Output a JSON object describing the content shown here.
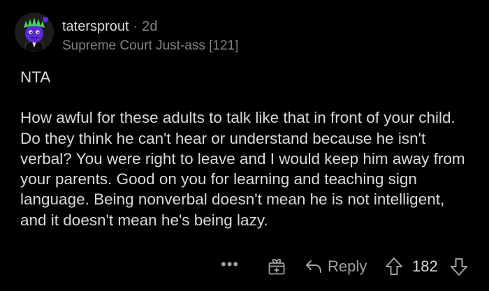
{
  "comment": {
    "author": "tatersprout",
    "separator": "·",
    "age": "2d",
    "flair": "Supreme Court Just-ass [121]",
    "paragraphs": [
      "NTA",
      "How awful for these adults to talk like that in front of your child. Do they think he can't hear or understand because he isn't verbal? You were right to leave and I would keep him away from your parents. Good on you for learning and teaching sign language. Being nonverbal doesn't mean he is not intelligent, and it doesn't mean he's being lazy."
    ]
  },
  "actions": {
    "more": "•••",
    "award_icon": "gift-icon",
    "reply_icon": "reply-arrow-icon",
    "reply_label": "Reply",
    "upvote_icon": "upvote-arrow-icon",
    "score": "182",
    "downvote_icon": "downvote-arrow-icon"
  },
  "colors": {
    "background": "#000000",
    "text_primary": "#d7dadc",
    "text_secondary": "#818384",
    "avatar_face": "#5b2bd6",
    "avatar_hair": "#46d160"
  }
}
